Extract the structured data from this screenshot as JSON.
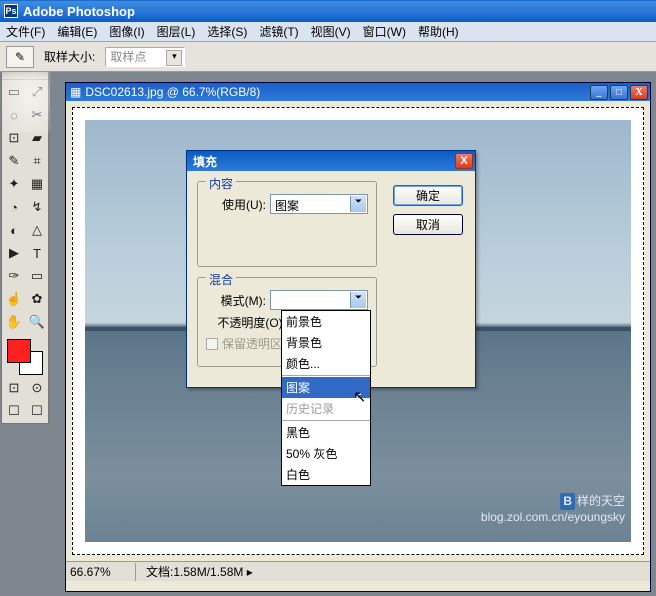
{
  "app": {
    "title": "Adobe Photoshop",
    "ps_icon": "Ps"
  },
  "menu": {
    "file": "文件(F)",
    "edit": "编辑(E)",
    "image": "图像(I)",
    "layer": "图层(L)",
    "select": "选择(S)",
    "filter": "滤镜(T)",
    "view": "视图(V)",
    "window": "窗口(W)",
    "help": "帮助(H)"
  },
  "optbar": {
    "sample_label": "取样大小:",
    "sample_value": "取样点",
    "eyedrop_glyph": "✎"
  },
  "tools": {
    "t00": "▭",
    "t01": "⤢",
    "t02": "◌",
    "t03": "✂",
    "t04": "⊡",
    "t05": "▰",
    "t06": "✎",
    "t07": "⌗",
    "t08": "✦",
    "t09": "▦",
    "t10": "◔",
    "t11": "↯",
    "t12": "◐",
    "t13": "△",
    "t14": "▶",
    "t15": "T",
    "t16": "✑",
    "t17": "▭",
    "t18": "☝",
    "t19": "✿",
    "t20": "✋",
    "t21": "🔍",
    "f0": "⊡",
    "f1": "⊙",
    "f2": "☐",
    "f3": "☐"
  },
  "doc": {
    "title": "DSC02613.jpg @ 66.7%(RGB/8)",
    "zoom": "66.67%",
    "stat_label": "文档:",
    "stat_value": "1.58M/1.58M",
    "doc_icon": "▦",
    "min": "_",
    "max": "□",
    "close": "X"
  },
  "watermark": {
    "line1_box": "B",
    "line1_text": "样的天空",
    "line2": "blog.zol.com.cn/eyoungsky"
  },
  "fill": {
    "title": "填充",
    "close": "X",
    "ok": "确定",
    "cancel": "取消",
    "fs_content": "内容",
    "use_lbl": "使用(U):",
    "use_val": "图案",
    "fs_blend": "混合",
    "mode_lbl": "模式(M):",
    "opacity_lbl": "不透明度(O):",
    "preserve_lbl": "保留透明区"
  },
  "ddopts": {
    "fore": "前景色",
    "back": "背景色",
    "color": "颜色...",
    "pattern": "图案",
    "history": "历史记录",
    "black": "黑色",
    "gray": "50% 灰色",
    "white": "白色"
  },
  "cursor": "↖"
}
